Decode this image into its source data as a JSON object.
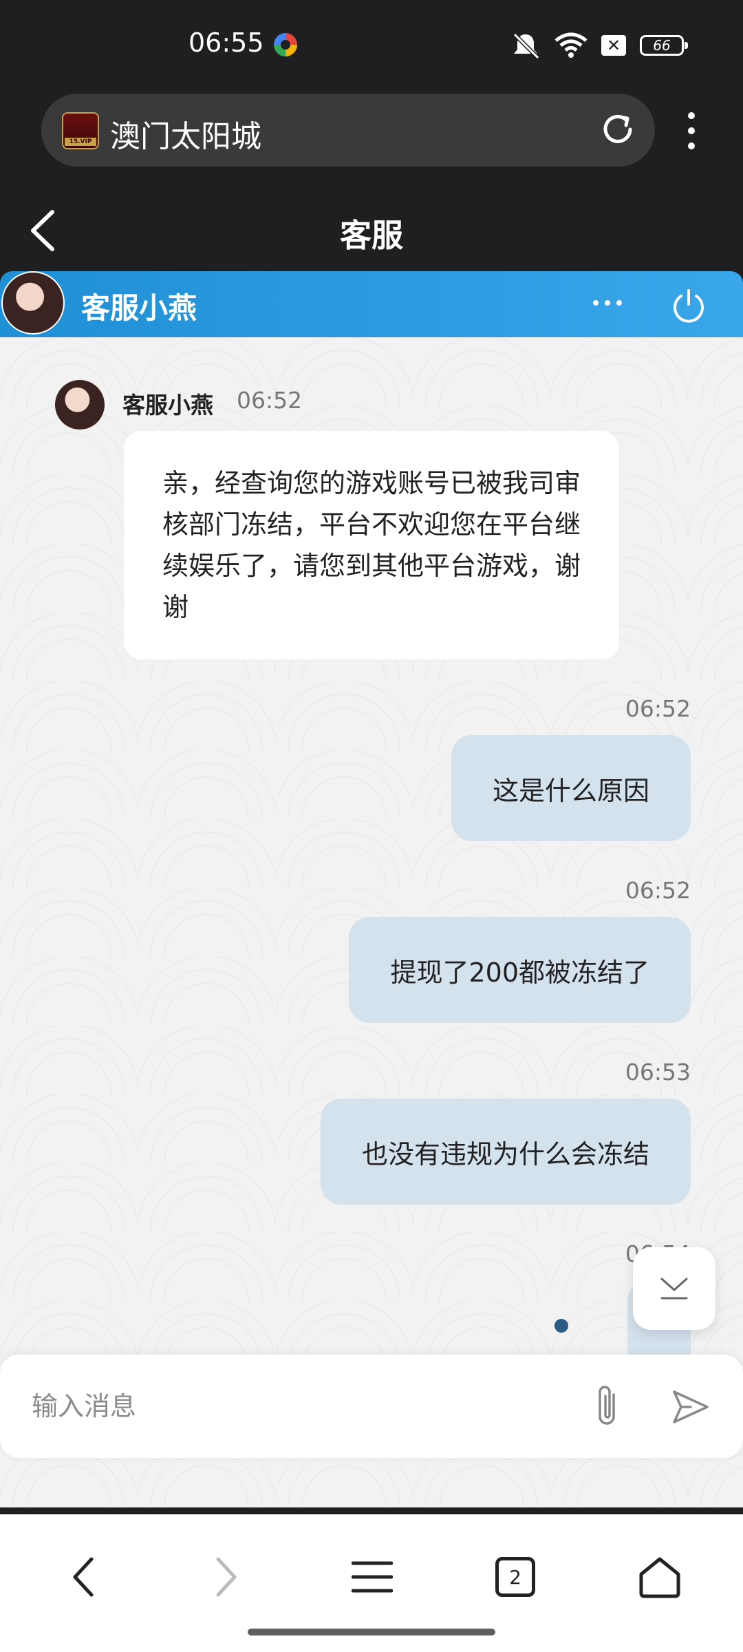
{
  "status_bar": {
    "time": "06:55",
    "battery": "66",
    "icons": [
      "app-logo-icon",
      "mute-icon",
      "wifi-icon",
      "x-box-icon",
      "battery-icon"
    ]
  },
  "browser": {
    "site_title": "澳门太阳城",
    "favicon_text": "15.VIP",
    "icons": [
      "reload-icon",
      "more-vert-icon"
    ]
  },
  "page": {
    "title": "客服"
  },
  "chat_header": {
    "agent_name": "客服小燕",
    "icons": [
      "more-horiz-icon",
      "power-icon"
    ]
  },
  "messages": [
    {
      "from": "agent",
      "name": "客服小燕",
      "time": "06:52",
      "text": "亲，经查询您的游戏账号已被我司审核部门冻结，平台不欢迎您在平台继续娱乐了，请您到其他平台游戏，谢谢"
    },
    {
      "from": "user",
      "time": "06:52",
      "text": "这是什么原因"
    },
    {
      "from": "user",
      "time": "06:52",
      "text": "提现了200都被冻结了"
    },
    {
      "from": "user",
      "time": "06:53",
      "text": "也没有违规为什么会冻结"
    },
    {
      "from": "user",
      "time": "06:54",
      "text": "?"
    }
  ],
  "input": {
    "placeholder": "输入消息",
    "value": ""
  },
  "bottom_nav": {
    "tab_count": "2",
    "icons": [
      "back-icon",
      "forward-icon",
      "menu-icon",
      "tabs-icon",
      "home-icon"
    ]
  },
  "colors": {
    "chat_header": "#2196e0",
    "user_bubble": "#d4e2ee",
    "agent_bubble": "#ffffff",
    "browser_bg": "#1f1f21"
  }
}
